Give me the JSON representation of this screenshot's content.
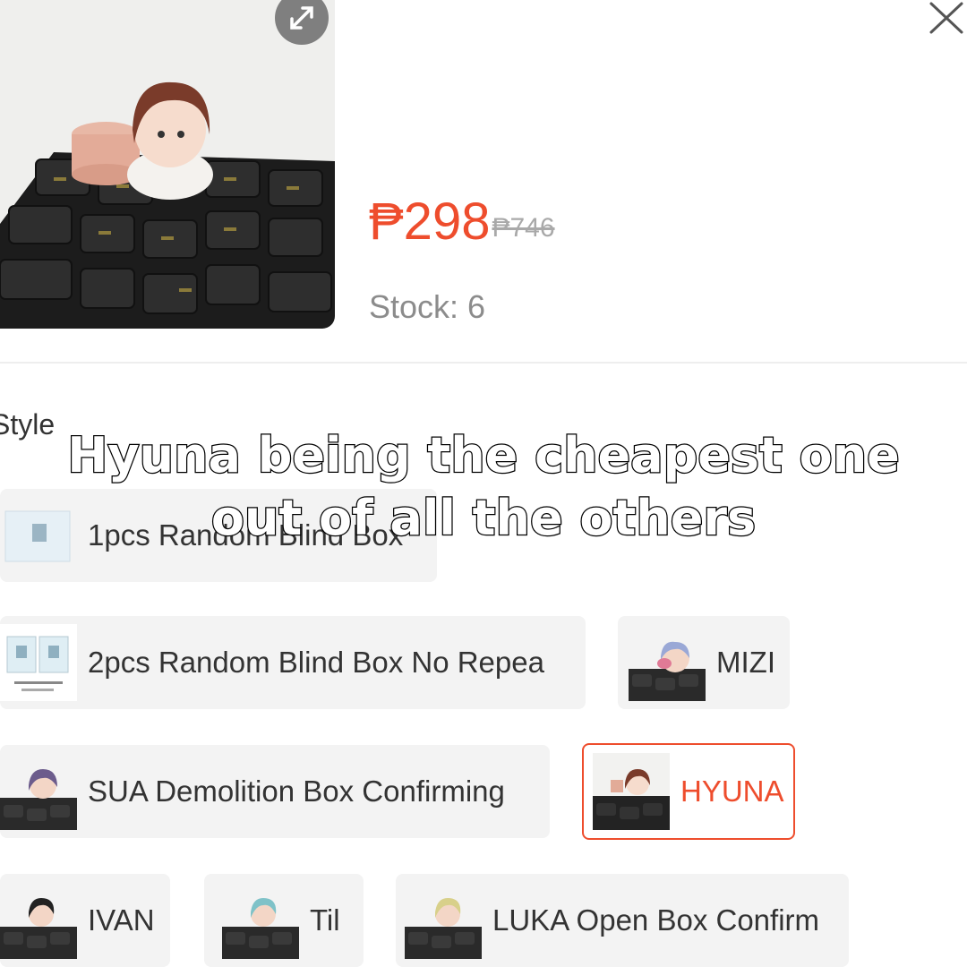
{
  "product": {
    "price": "₱298",
    "original_price": "₱746",
    "stock": "Stock: 6"
  },
  "variations": {
    "label": "Style",
    "options": [
      {
        "label": "1pcs Random Blind Box",
        "thumb": "box-icon"
      },
      {
        "label": "2pcs Random Blind Box No Repea",
        "thumb": "box-icon"
      },
      {
        "label": "MIZI",
        "thumb": "figure-icon"
      },
      {
        "label": "SUA Demolition Box Confirming",
        "thumb": "figure-icon"
      },
      {
        "label": "HYUNA",
        "thumb": "figure-icon",
        "selected": true
      },
      {
        "label": "IVAN",
        "thumb": "figure-icon"
      },
      {
        "label": "Til",
        "thumb": "figure-icon"
      },
      {
        "label": "LUKA Open Box Confirm",
        "thumb": "figure-icon"
      }
    ]
  },
  "caption": {
    "line1": "Hyuna being the cheapest one",
    "line2": "out of all the others"
  },
  "colors": {
    "accent": "#ee4d2d",
    "option_bg": "#f3f3f3"
  }
}
